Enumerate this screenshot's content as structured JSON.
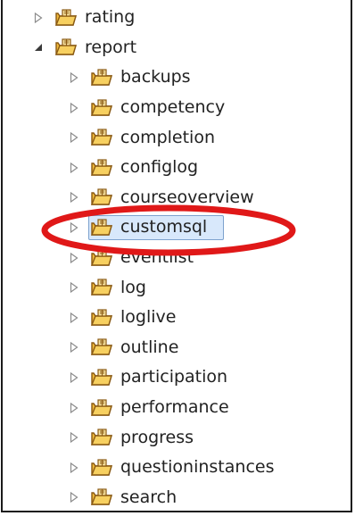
{
  "tree": {
    "parent_items": [
      {
        "label": "rating",
        "expanded": false
      },
      {
        "label": "report",
        "expanded": true
      }
    ],
    "children": [
      {
        "label": "backups"
      },
      {
        "label": "competency"
      },
      {
        "label": "completion"
      },
      {
        "label": "configlog"
      },
      {
        "label": "courseoverview"
      },
      {
        "label": "customsql",
        "selected": true
      },
      {
        "label": "eventlist"
      },
      {
        "label": "log"
      },
      {
        "label": "loglive"
      },
      {
        "label": "outline"
      },
      {
        "label": "participation"
      },
      {
        "label": "performance"
      },
      {
        "label": "progress"
      },
      {
        "label": "questioninstances"
      },
      {
        "label": "search"
      }
    ]
  },
  "colors": {
    "folder_fill": "#f5c84c",
    "folder_outline": "#8a5a14",
    "highlight_oval": "#e01818",
    "selection_bg": "#d8e8fb",
    "selection_border": "#7da2ce"
  },
  "icons": {
    "collapsed": "chevron-right-outline-icon",
    "expanded": "chevron-down-filled-icon",
    "folder": "package-folder-icon"
  }
}
